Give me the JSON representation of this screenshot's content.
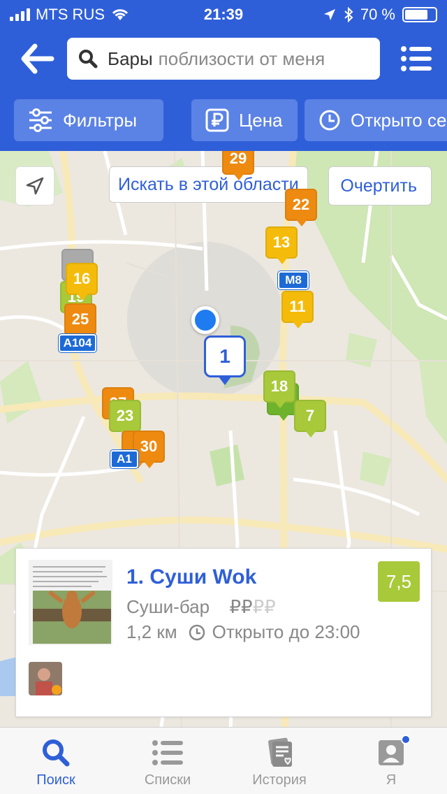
{
  "status_bar": {
    "carrier": "MTS RUS",
    "time": "21:39",
    "battery": "70 %",
    "battery_level": 0.7
  },
  "header": {
    "search_query": "Бары",
    "search_hint": "поблизости от меня"
  },
  "filters": [
    {
      "label": "Фильтры",
      "icon": "sliders-icon"
    },
    {
      "label": "Цена",
      "icon": "ruble-icon"
    },
    {
      "label": "Открыто сейчас",
      "icon": "clock-icon"
    }
  ],
  "map": {
    "search_area_label": "Искать в этой области",
    "draw_label": "Очертить",
    "selected_pin": "1",
    "pins": [
      {
        "label": "29",
        "color": "orange"
      },
      {
        "label": "22",
        "color": "orange"
      },
      {
        "label": "13",
        "color": "yellow"
      },
      {
        "label": "16",
        "color": "yellow"
      },
      {
        "label": "19",
        "color": "lime"
      },
      {
        "label": "25",
        "color": "orange"
      },
      {
        "label": "11",
        "color": "yellow"
      },
      {
        "label": "18",
        "color": "lime"
      },
      {
        "label": "7",
        "color": "lime"
      },
      {
        "label": "27",
        "color": "orange"
      },
      {
        "label": "23",
        "color": "lime"
      },
      {
        "label": "2",
        "color": "orange"
      },
      {
        "label": "30",
        "color": "orange"
      }
    ],
    "route_signs": [
      "M8",
      "A104",
      "A1"
    ]
  },
  "card": {
    "name": "1. Суши Wok",
    "category": "Суши-бар",
    "price_active": "₽₽",
    "price_inactive": "₽₽",
    "distance": "1,2 км",
    "hours": "Открыто до 23:00",
    "rating": "7,5"
  },
  "tabbar": {
    "tabs": [
      {
        "label": "Поиск",
        "icon": "search-icon",
        "active": true
      },
      {
        "label": "Списки",
        "icon": "list-icon",
        "active": false
      },
      {
        "label": "История",
        "icon": "history-icon",
        "active": false
      },
      {
        "label": "Я",
        "icon": "profile-icon",
        "active": false
      }
    ]
  },
  "colors": {
    "primary": "#2f5fd8",
    "chip": "#5b82e5",
    "rating_green": "#a8c93a",
    "pin_yellow": "#f4bb0a",
    "pin_orange": "#ee8a10",
    "user_dot": "#1e7cf0"
  }
}
